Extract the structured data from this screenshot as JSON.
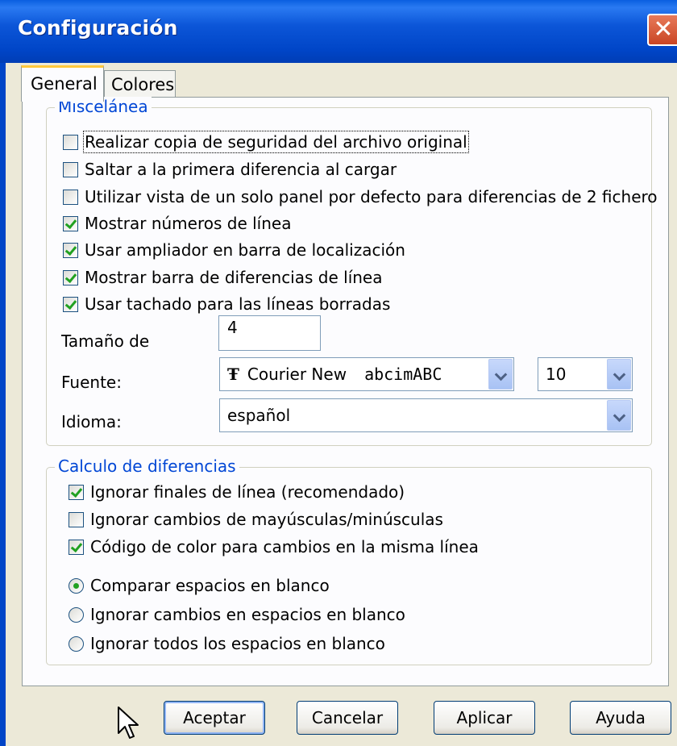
{
  "window": {
    "title": "Configuración",
    "close_label": "✕"
  },
  "tabs": [
    {
      "label": "General"
    },
    {
      "label": "Colores"
    }
  ],
  "misc_group": {
    "title": "Miscelánea",
    "checkboxes": [
      {
        "label": "Realizar copia de seguridad del archivo original",
        "checked": false
      },
      {
        "label": "Saltar a la primera diferencia al cargar",
        "checked": false
      },
      {
        "label": "Utilizar vista de un solo panel por defecto para diferencias de 2 fichero",
        "checked": false
      },
      {
        "label": "Mostrar números de línea",
        "checked": true
      },
      {
        "label": "Usar ampliador en barra de localización",
        "checked": true
      },
      {
        "label": "Mostrar barra de diferencias de línea",
        "checked": true
      },
      {
        "label": "Usar tachado para las líneas borradas",
        "checked": true
      }
    ],
    "tab_size": {
      "label": "Tamaño de",
      "value": "4"
    },
    "font": {
      "label": "Fuente:",
      "name": "Courier New",
      "sample": "abcimABC",
      "size": "10"
    },
    "language": {
      "label": "Idioma:",
      "value": "español"
    }
  },
  "diff_group": {
    "title": "Calculo de diferencias",
    "checkboxes": [
      {
        "label": "Ignorar finales de línea (recomendado)",
        "checked": true
      },
      {
        "label": "Ignorar cambios de mayúsculas/minúsculas",
        "checked": false
      },
      {
        "label": "Código de color para cambios en la misma línea",
        "checked": true
      }
    ],
    "radios": [
      {
        "label": "Comparar espacios en blanco",
        "checked": true
      },
      {
        "label": "Ignorar cambios en espacios en blanco",
        "checked": false
      },
      {
        "label": "Ignorar todos los espacios en blanco",
        "checked": false
      }
    ]
  },
  "buttons": {
    "ok": "Aceptar",
    "cancel": "Cancelar",
    "apply": "Aplicar",
    "help": "Ayuda"
  },
  "icons": {
    "close": "close-icon",
    "font": "truetype-font-icon",
    "dropdown": "chevron-down-icon",
    "cursor": "mouse-pointer-icon"
  },
  "colors": {
    "titlebar": "#0045c7",
    "group_title": "#0046d5",
    "check": "#21a121",
    "dialog_bg": "#ece9d8"
  }
}
